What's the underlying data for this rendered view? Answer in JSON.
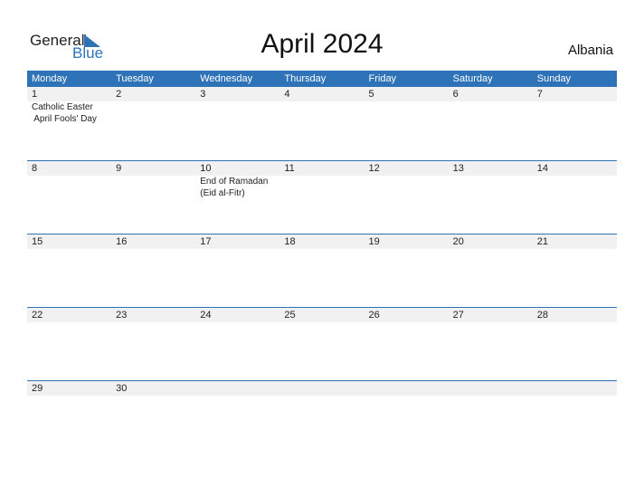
{
  "logo": {
    "general": "General",
    "blue": "Blue"
  },
  "title": "April 2024",
  "country": "Albania",
  "colors": {
    "accent": "#2e73b8",
    "band": "#f1f1f1"
  },
  "weekdays": [
    "Monday",
    "Tuesday",
    "Wednesday",
    "Thursday",
    "Friday",
    "Saturday",
    "Sunday"
  ],
  "weeks": [
    {
      "days": [
        "1",
        "2",
        "3",
        "4",
        "5",
        "6",
        "7"
      ],
      "events": [
        [
          "Catholic Easter",
          " April Fools' Day"
        ],
        [],
        [],
        [],
        [],
        [],
        []
      ]
    },
    {
      "days": [
        "8",
        "9",
        "10",
        "11",
        "12",
        "13",
        "14"
      ],
      "events": [
        [],
        [],
        [
          "End of Ramadan",
          "(Eid al-Fitr)"
        ],
        [],
        [],
        [],
        []
      ]
    },
    {
      "days": [
        "15",
        "16",
        "17",
        "18",
        "19",
        "20",
        "21"
      ],
      "events": [
        [],
        [],
        [],
        [],
        [],
        [],
        []
      ]
    },
    {
      "days": [
        "22",
        "23",
        "24",
        "25",
        "26",
        "27",
        "28"
      ],
      "events": [
        [],
        [],
        [],
        [],
        [],
        [],
        []
      ]
    },
    {
      "days": [
        "29",
        "30",
        "",
        "",
        "",
        "",
        ""
      ],
      "events": [
        [],
        [],
        [],
        [],
        [],
        [],
        []
      ]
    }
  ]
}
